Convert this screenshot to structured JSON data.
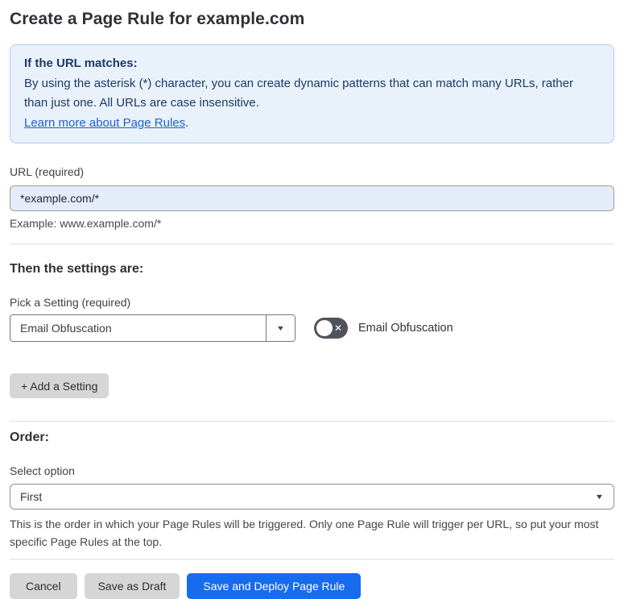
{
  "page": {
    "title": "Create a Page Rule for example.com"
  },
  "info_box": {
    "heading": "If the URL matches:",
    "body": "By using the asterisk (*) character, you can create dynamic patterns that can match many URLs, rather than just one. All URLs are case insensitive.",
    "link_label": "Learn more about Page Rules",
    "link_suffix": "."
  },
  "url_field": {
    "label": "URL (required)",
    "value": "*example.com/*",
    "hint": "Example: www.example.com/*"
  },
  "settings_section": {
    "heading": "Then the settings are:",
    "picker_label": "Pick a Setting (required)",
    "picker_value": "Email Obfuscation",
    "toggle_label": "Email Obfuscation",
    "toggle_state": "off",
    "add_button_label": "+ Add a Setting"
  },
  "order_section": {
    "heading": "Order:",
    "select_label": "Select option",
    "select_value": "First",
    "description": "This is the order in which your Page Rules will be triggered. Only one Page Rule will trigger per URL, so put your most specific Page Rules at the top."
  },
  "footer": {
    "cancel_label": "Cancel",
    "save_draft_label": "Save as Draft",
    "save_deploy_label": "Save and Deploy Page Rule"
  },
  "icons": {
    "caret_down": "▼",
    "toggle_x": "✕"
  },
  "colors": {
    "accent_blue": "#176cee",
    "info_bg": "#e9f1fb",
    "info_border": "#b2cfec",
    "info_text": "#1d3a66",
    "link_blue": "#2163c8",
    "input_highlight_bg": "#e4ecfa",
    "toggle_off_bg": "#50535a",
    "gray_button_bg": "#d6d6d6"
  }
}
